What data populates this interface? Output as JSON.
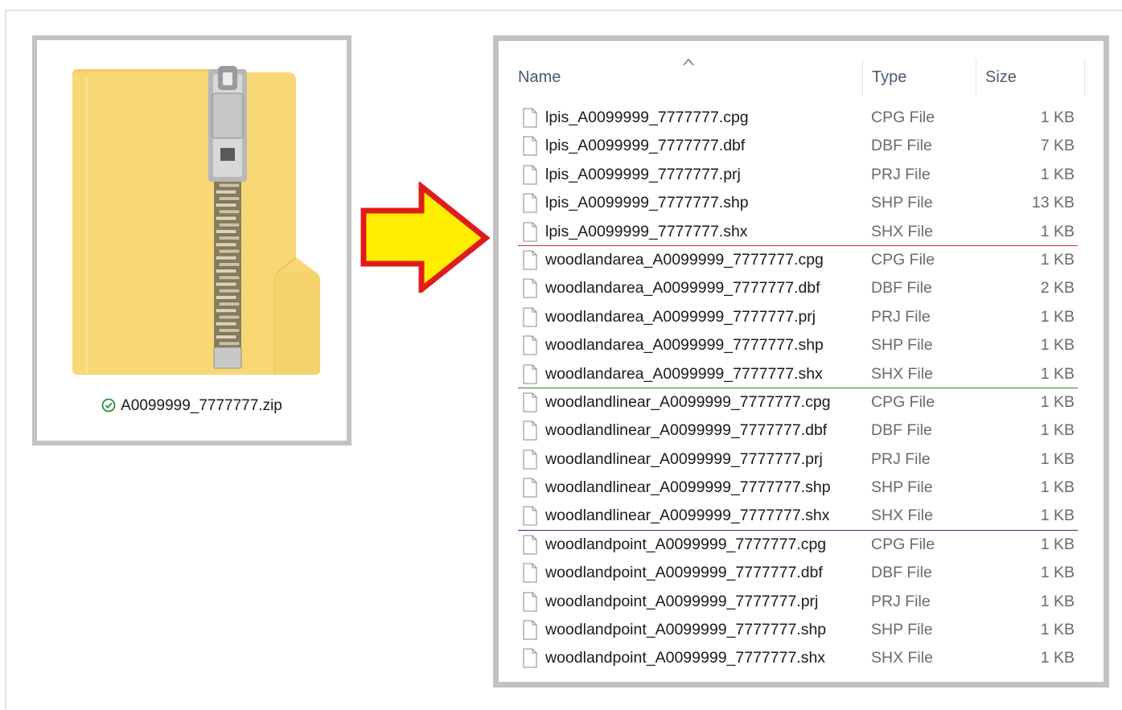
{
  "zip": {
    "filename": "A0099999_7777777.zip",
    "status_icon": "check-circle-icon",
    "status_color": "#2e8b3e",
    "folder_color": "#f8d775",
    "folder_dark": "#eec453"
  },
  "arrow": {
    "fill": "#ffee00",
    "stroke": "#e01b1b",
    "icon": "right-arrow-icon"
  },
  "explorer": {
    "columns": {
      "name": "Name",
      "type": "Type",
      "size": "Size"
    },
    "sort_indicator": "sort-ascending-caret-icon",
    "group_line_colors": [
      "#c0392b",
      "#2e7d32",
      "#283593"
    ],
    "files": [
      {
        "name": "lpis_A0099999_7777777.cpg",
        "type": "CPG File",
        "size": "1 KB"
      },
      {
        "name": "lpis_A0099999_7777777.dbf",
        "type": "DBF File",
        "size": "7 KB"
      },
      {
        "name": "lpis_A0099999_7777777.prj",
        "type": "PRJ File",
        "size": "1 KB"
      },
      {
        "name": "lpis_A0099999_7777777.shp",
        "type": "SHP File",
        "size": "13 KB"
      },
      {
        "name": "lpis_A0099999_7777777.shx",
        "type": "SHX File",
        "size": "1 KB"
      },
      {
        "name": "woodlandarea_A0099999_7777777.cpg",
        "type": "CPG File",
        "size": "1 KB"
      },
      {
        "name": "woodlandarea_A0099999_7777777.dbf",
        "type": "DBF File",
        "size": "2 KB"
      },
      {
        "name": "woodlandarea_A0099999_7777777.prj",
        "type": "PRJ File",
        "size": "1 KB"
      },
      {
        "name": "woodlandarea_A0099999_7777777.shp",
        "type": "SHP File",
        "size": "1 KB"
      },
      {
        "name": "woodlandarea_A0099999_7777777.shx",
        "type": "SHX File",
        "size": "1 KB"
      },
      {
        "name": "woodlandlinear_A0099999_7777777.cpg",
        "type": "CPG File",
        "size": "1 KB"
      },
      {
        "name": "woodlandlinear_A0099999_7777777.dbf",
        "type": "DBF File",
        "size": "1 KB"
      },
      {
        "name": "woodlandlinear_A0099999_7777777.prj",
        "type": "PRJ File",
        "size": "1 KB"
      },
      {
        "name": "woodlandlinear_A0099999_7777777.shp",
        "type": "SHP File",
        "size": "1 KB"
      },
      {
        "name": "woodlandlinear_A0099999_7777777.shx",
        "type": "SHX File",
        "size": "1 KB"
      },
      {
        "name": "woodlandpoint_A0099999_7777777.cpg",
        "type": "CPG File",
        "size": "1 KB"
      },
      {
        "name": "woodlandpoint_A0099999_7777777.dbf",
        "type": "DBF File",
        "size": "1 KB"
      },
      {
        "name": "woodlandpoint_A0099999_7777777.prj",
        "type": "PRJ File",
        "size": "1 KB"
      },
      {
        "name": "woodlandpoint_A0099999_7777777.shp",
        "type": "SHP File",
        "size": "1 KB"
      },
      {
        "name": "woodlandpoint_A0099999_7777777.shx",
        "type": "SHX File",
        "size": "1 KB"
      }
    ]
  }
}
